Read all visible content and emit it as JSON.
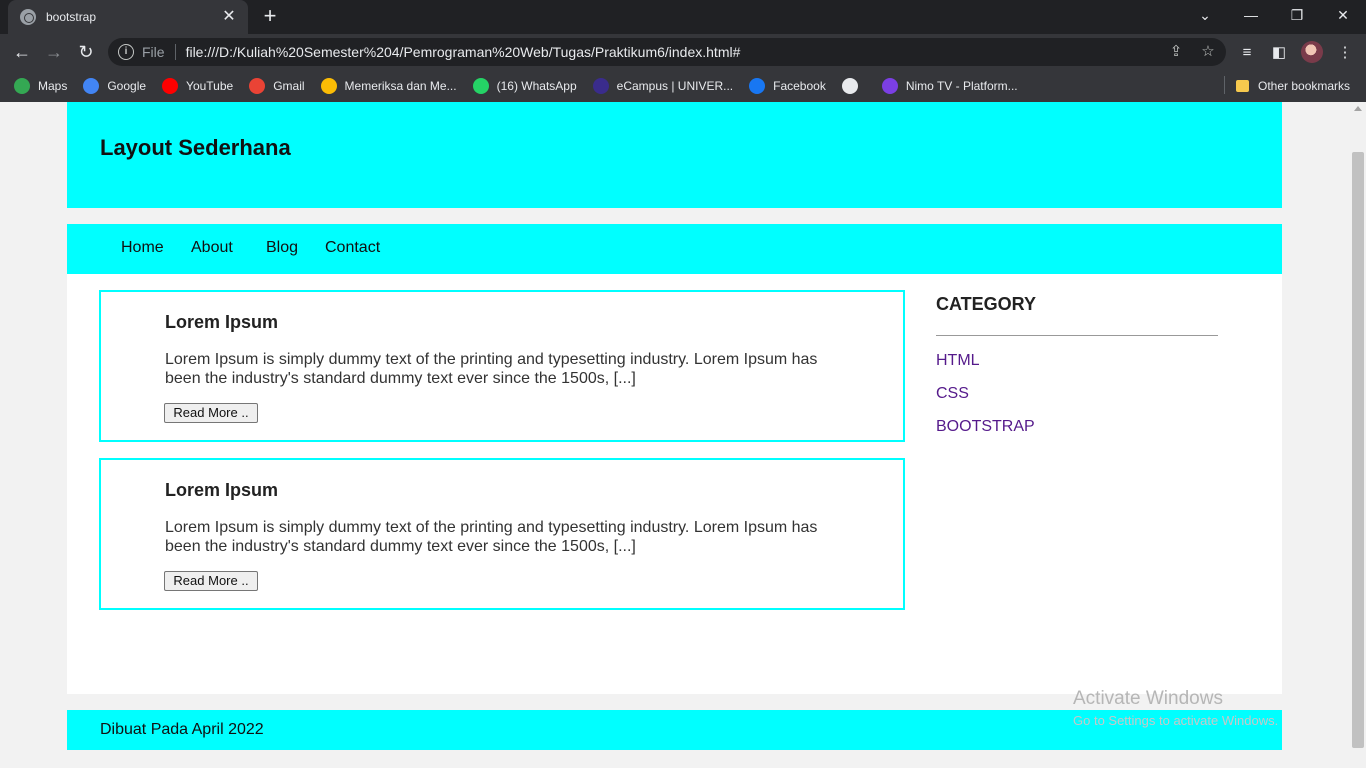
{
  "browser": {
    "tab_title": "bootstrap",
    "tab_close": "✕",
    "new_tab": "+",
    "url_scheme": "File",
    "url": "file:///D:/Kuliah%20Semester%204/Pemrograman%20Web/Tugas/Praktikum6/index.html#",
    "bookmarks": [
      {
        "label": "Maps",
        "icon": "maps-icon",
        "color": "#34a853"
      },
      {
        "label": "Google",
        "icon": "google-icon",
        "color": "#4285f4"
      },
      {
        "label": "YouTube",
        "icon": "youtube-icon",
        "color": "#ff0000"
      },
      {
        "label": "Gmail",
        "icon": "gmail-icon",
        "color": "#ea4335"
      },
      {
        "label": "Memeriksa dan Me...",
        "icon": "chrome-icon",
        "color": "#fbbc05"
      },
      {
        "label": "(16) WhatsApp",
        "icon": "whatsapp-icon",
        "color": "#25d366"
      },
      {
        "label": "eCampus | UNIVER...",
        "icon": "ecampus-icon",
        "color": "#3a2c8c"
      },
      {
        "label": "Facebook",
        "icon": "facebook-icon",
        "color": "#1877f2"
      },
      {
        "label": "",
        "icon": "globe-icon",
        "color": "#e8eaed"
      },
      {
        "label": "Nimo TV - Platform...",
        "icon": "nimo-tv-icon",
        "color": "#7b3fe4"
      }
    ],
    "other_bookmarks": "Other bookmarks"
  },
  "page": {
    "header_title": "Layout Sederhana",
    "nav": [
      "Home",
      "About",
      "Blog",
      "Contact"
    ],
    "articles": [
      {
        "title": "Lorem Ipsum",
        "text": "Lorem Ipsum is simply dummy text of the printing and typesetting industry. Lorem Ipsum has been the industry's standard dummy text ever since the 1500s, [...]",
        "button": "Read More .."
      },
      {
        "title": "Lorem Ipsum",
        "text": "Lorem Ipsum is simply dummy text of the printing and typesetting industry. Lorem Ipsum has been the industry's standard dummy text ever since the 1500s, [...]",
        "button": "Read More .."
      }
    ],
    "sidebar": {
      "heading": "CATEGORY",
      "links": [
        "HTML",
        "CSS",
        "BOOTSTRAP"
      ]
    },
    "footer": "Dibuat Pada April 2022"
  },
  "watermark": {
    "line1": "Activate Windows",
    "line2": "Go to Settings to activate Windows."
  },
  "colors": {
    "accent": "#00ffff",
    "link": "#551a8b",
    "chrome_dark": "#202124",
    "chrome_toolbar": "#35363a"
  }
}
